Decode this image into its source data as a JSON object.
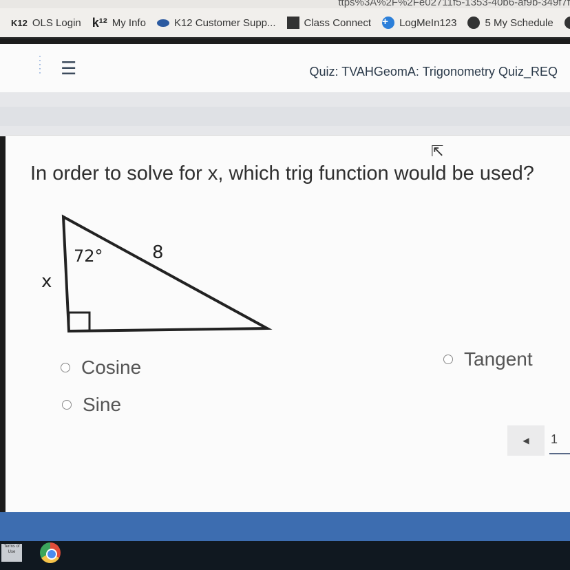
{
  "urlbar": {
    "text": "ttps%3A%2F%2Fe02711f5-1353-40b6-af9b-349f7f"
  },
  "bookmarks": [
    {
      "label": "OLS Login",
      "icon": "k12-logo-icon",
      "icon_text": "K12"
    },
    {
      "label": "My Info",
      "icon": "k12-k-icon",
      "icon_text": "k¹²"
    },
    {
      "label": "K12 Customer Supp...",
      "icon": "cloud-icon"
    },
    {
      "label": "Class Connect",
      "icon": "class-connect-icon"
    },
    {
      "label": "LogMeIn123",
      "icon": "plus-circle-icon"
    },
    {
      "label": "5 My Schedule",
      "icon": "schedule-icon"
    }
  ],
  "header": {
    "quiz_title": "Quiz: TVAHGeomA: Trigonometry Quiz_REQ"
  },
  "question": {
    "text": "In order to solve for x, which trig function would be used?",
    "figure": {
      "angle_label": "72°",
      "hypotenuse_label": "8",
      "side_label": "x"
    }
  },
  "choices": [
    {
      "label": "Cosine"
    },
    {
      "label": "Sine"
    },
    {
      "label": "Tangent"
    }
  ],
  "pager": {
    "prev_glyph": "◀",
    "current_page": "1"
  },
  "taskbar": {
    "terms_text": "Terms of Use"
  },
  "colors": {
    "accent_blue": "#3d6db0",
    "text_dark": "#2f2f2f"
  }
}
